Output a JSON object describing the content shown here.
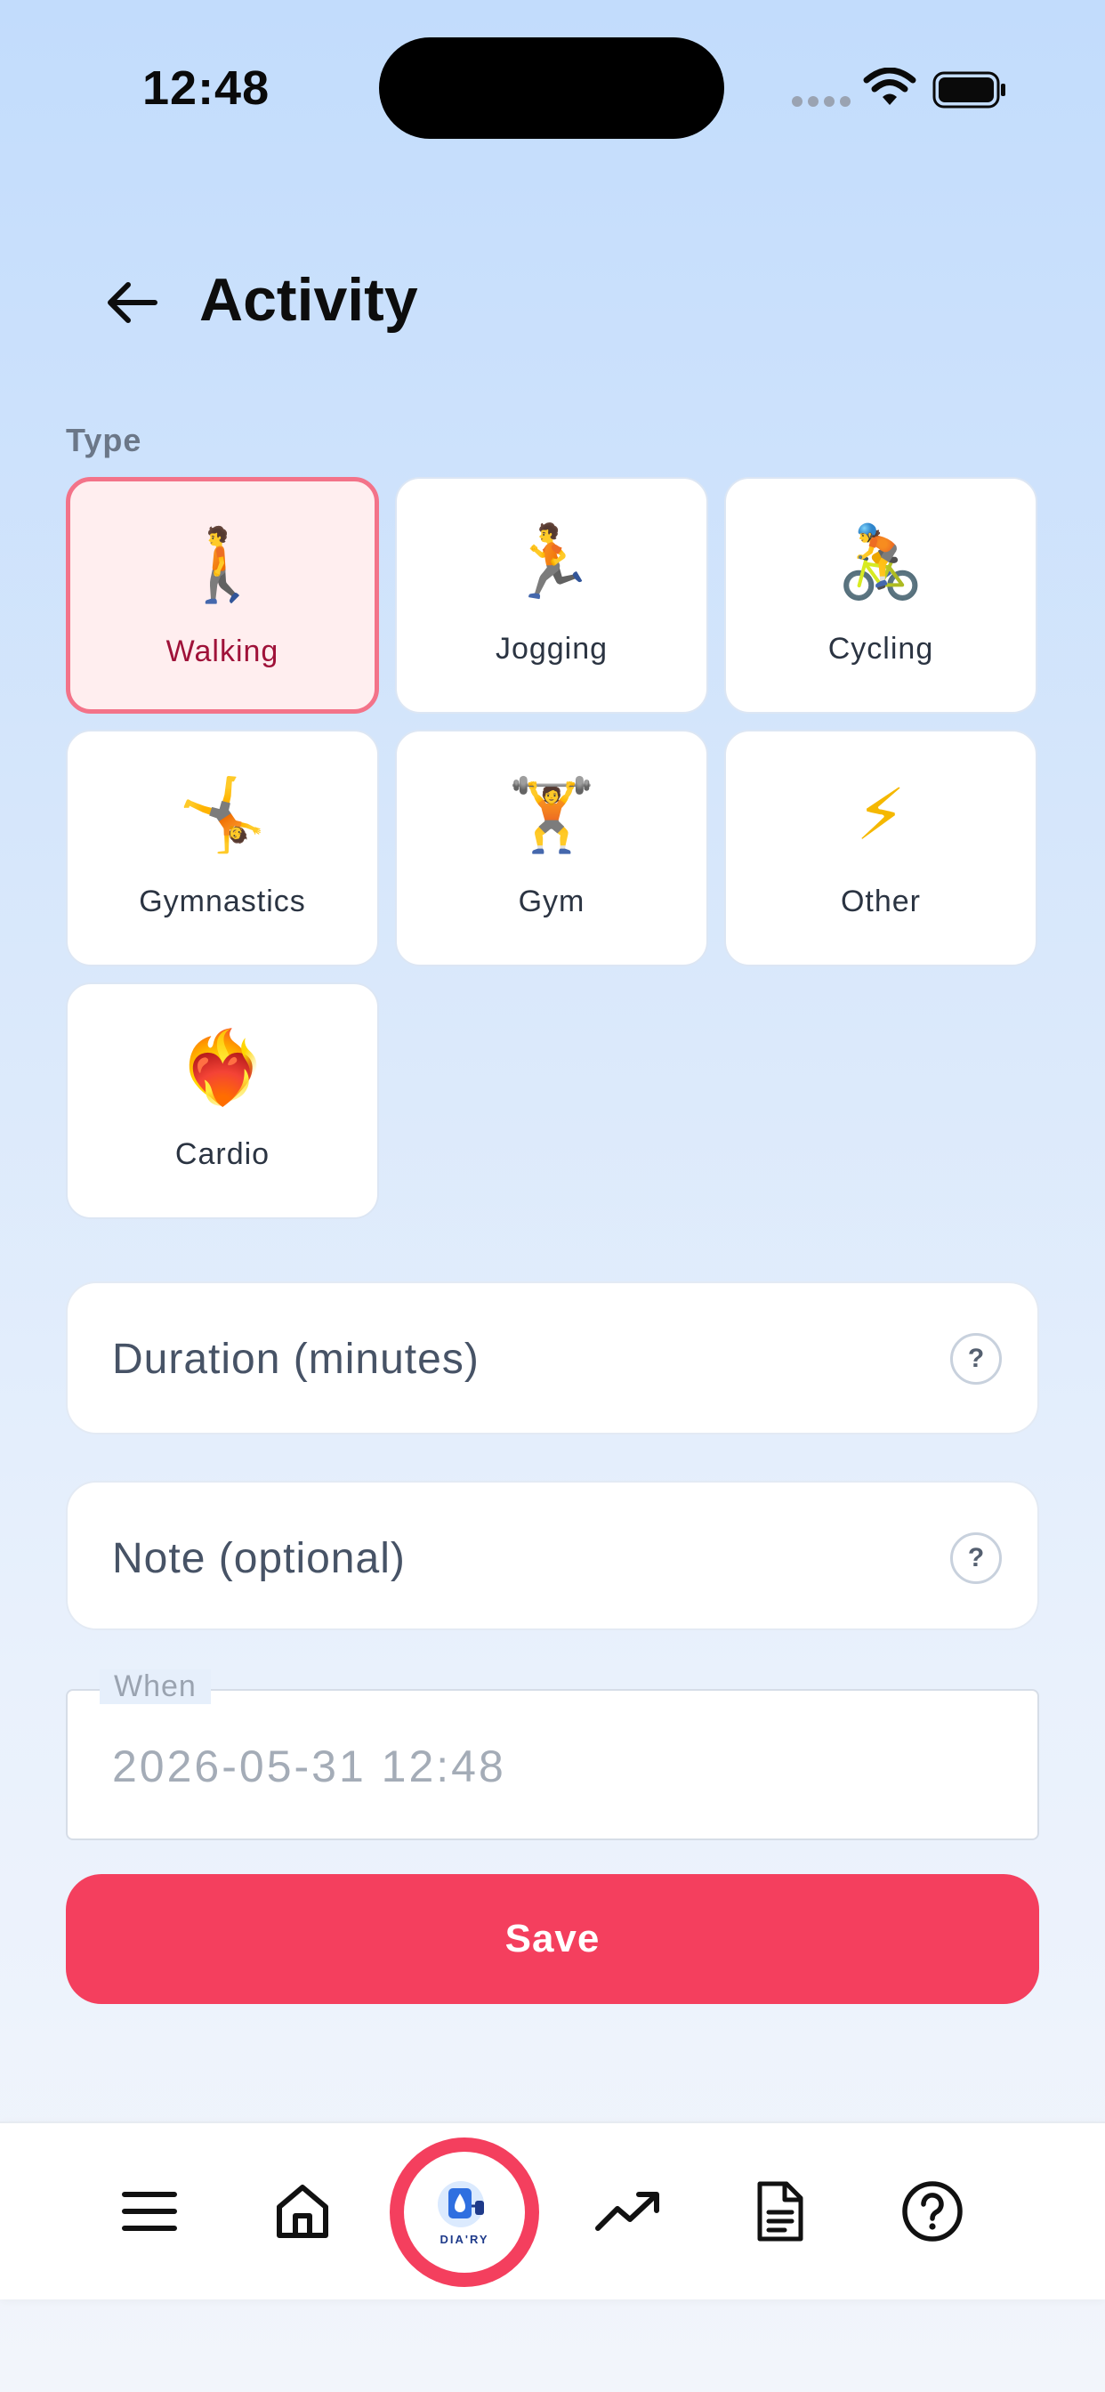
{
  "status_bar": {
    "time": "12:48"
  },
  "header": {
    "title": "Activity"
  },
  "type_section": {
    "label": "Type",
    "options": [
      {
        "label": "Walking",
        "emoji": "🚶",
        "selected": true
      },
      {
        "label": "Jogging",
        "emoji": "🏃",
        "selected": false
      },
      {
        "label": "Cycling",
        "emoji": "🚴",
        "selected": false
      },
      {
        "label": "Gymnastics",
        "emoji": "🤸",
        "selected": false
      },
      {
        "label": "Gym",
        "emoji": "🏋️",
        "selected": false
      },
      {
        "label": "Other",
        "emoji": "⚡",
        "selected": false
      },
      {
        "label": "Cardio",
        "emoji": "❤️‍🔥",
        "selected": false
      }
    ]
  },
  "form": {
    "duration_placeholder": "Duration (minutes)",
    "note_placeholder": "Note (optional)",
    "help_glyph": "?",
    "when_label": "When",
    "when_value": "2026-05-31  12:48"
  },
  "save": {
    "label": "Save"
  },
  "bottom_nav": {
    "items": [
      {
        "icon": "menu-icon"
      },
      {
        "icon": "home-icon"
      },
      {
        "icon": "diary-logo-icon",
        "logo_text": "DIA'RY"
      },
      {
        "icon": "trending-up-icon"
      },
      {
        "icon": "document-icon"
      },
      {
        "icon": "help-circle-icon"
      }
    ]
  },
  "colors": {
    "accent": "#f43f5e",
    "selected_border": "#f37389",
    "selected_bg": "#ffeeef",
    "background_top": "#c2dcfc"
  }
}
